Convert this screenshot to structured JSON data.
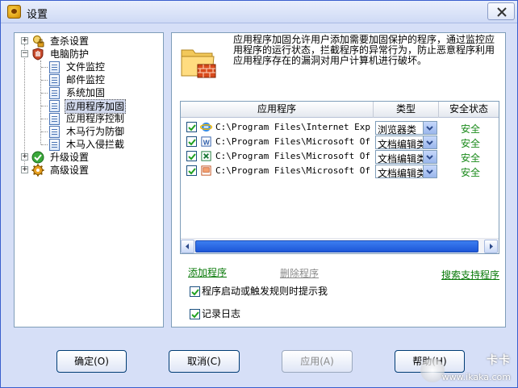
{
  "window": {
    "title": "设置",
    "app_icon": "app-logo-icon",
    "close_icon": "close-icon"
  },
  "tree": {
    "items": [
      {
        "label": "查杀设置",
        "icon": "magnifier-lock-icon",
        "expander": "+"
      },
      {
        "label": "电脑防护",
        "icon": "shield-hand-icon",
        "expander": "−"
      },
      {
        "label": "文件监控",
        "icon": "document-icon"
      },
      {
        "label": "邮件监控",
        "icon": "document-icon"
      },
      {
        "label": "系统加固",
        "icon": "document-icon"
      },
      {
        "label": "应用程序加固",
        "icon": "document-icon",
        "selected": true
      },
      {
        "label": "应用程序控制",
        "icon": "document-icon"
      },
      {
        "label": "木马行为防御",
        "icon": "document-icon"
      },
      {
        "label": "木马入侵拦截",
        "icon": "document-icon"
      },
      {
        "label": "升级设置",
        "icon": "green-check-icon",
        "expander": "+"
      },
      {
        "label": "高级设置",
        "icon": "gear-icon",
        "expander": "+"
      }
    ]
  },
  "description": "应用程序加固允许用户添加需要加固保护的程序，通过监控应用程序的运行状态，拦截程序的异常行为，防止恶意程序利用应用程序存在的漏洞对用户计算机进行破坏。",
  "grid": {
    "headers": {
      "app": "应用程序",
      "type": "类型",
      "status": "安全状态"
    },
    "rows": [
      {
        "checked": true,
        "icon": "internet-explorer-icon",
        "path": "C:\\Program Files\\Internet Exp...",
        "type": "浏览器类",
        "status": "安全"
      },
      {
        "checked": true,
        "icon": "word-icon",
        "path": "C:\\Program Files\\Microsoft Of...",
        "type": "文档编辑类",
        "status": "安全"
      },
      {
        "checked": true,
        "icon": "excel-icon",
        "path": "C:\\Program Files\\Microsoft Of...",
        "type": "文档编辑类",
        "status": "安全"
      },
      {
        "checked": true,
        "icon": "powerpoint-icon",
        "path": "C:\\Program Files\\Microsoft Of...",
        "type": "文档编辑类",
        "status": "安全"
      }
    ]
  },
  "links": {
    "add": "添加程序",
    "delete": "删除程序",
    "search": "搜索支持程序"
  },
  "options": {
    "prompt_label": "程序启动或触发规则时提示我",
    "prompt_checked": true,
    "log_label": "记录日志",
    "log_checked": true
  },
  "buttons": {
    "ok": "确定(O)",
    "cancel": "取消(C)",
    "apply": "应用(A)",
    "help": "帮助(H)"
  },
  "watermark": {
    "brand": "卡卡",
    "url": "www.ikaka.com"
  },
  "colors": {
    "status_green": "#1a8a1a",
    "link_green": "#0a7a0a",
    "selection": "#d4dbef"
  }
}
